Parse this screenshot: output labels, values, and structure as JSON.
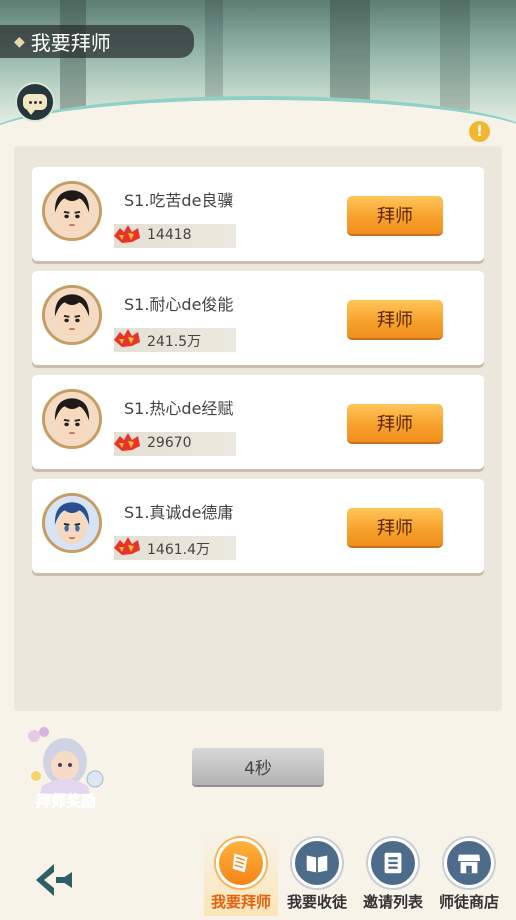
{
  "header": {
    "title": "我要拜师"
  },
  "cards": [
    {
      "name": "S1.吃苦de良骥",
      "power": "14418",
      "button": "拜师",
      "avatar_icon": "male-avatar-icon"
    },
    {
      "name": "S1.耐心de俊能",
      "power": "241.5万",
      "button": "拜师",
      "avatar_icon": "male-avatar-icon"
    },
    {
      "name": "S1.热心de经赋",
      "power": "29670",
      "button": "拜师",
      "avatar_icon": "male-avatar-icon"
    },
    {
      "name": "S1.真诚de德庸",
      "power": "1461.4万",
      "button": "拜师",
      "avatar_icon": "female-avatar-icon"
    }
  ],
  "reward": {
    "label": "拜师奖励"
  },
  "countdown": {
    "label": "4秒"
  },
  "tabs": [
    {
      "label": "我要拜师",
      "icon": "scroll-icon",
      "active": true
    },
    {
      "label": "我要收徒",
      "icon": "book-icon",
      "active": false
    },
    {
      "label": "邀请列表",
      "icon": "list-icon",
      "active": false
    },
    {
      "label": "师徒商店",
      "icon": "shop-icon",
      "active": false
    }
  ],
  "colors": {
    "accent": "#f7a22c",
    "tab_active_text": "#e3610f",
    "tab_icon_bg": "#4d6b8b"
  }
}
